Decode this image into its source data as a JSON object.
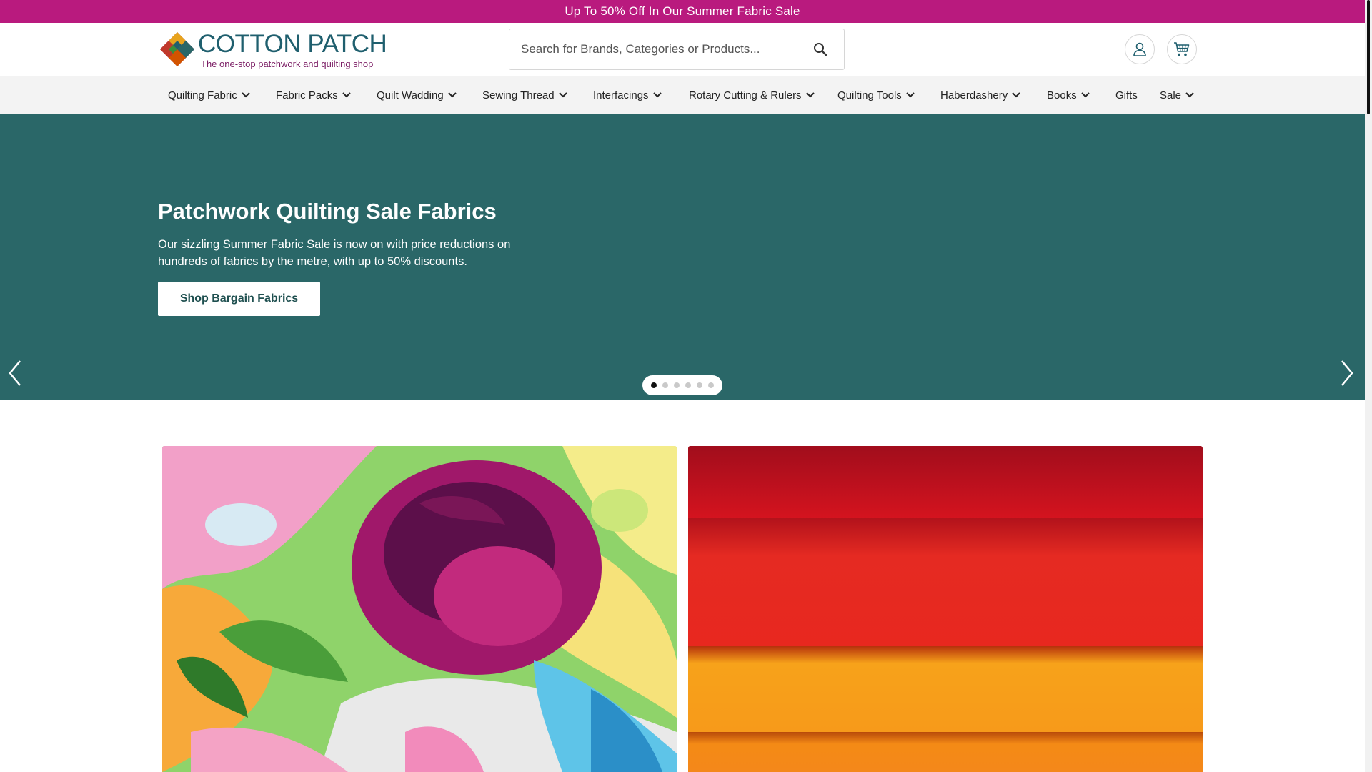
{
  "promo": {
    "text": "Up To 50% Off In Our Summer Fabric Sale"
  },
  "brand": {
    "name": "COTTON PATCH",
    "tagline": "The one-stop patchwork and quilting shop",
    "primary_color": "#1f5f6e",
    "accent_color": "#b91a7e"
  },
  "search": {
    "placeholder": "Search for Brands, Categories or Products...",
    "value": "",
    "icon": "search-icon"
  },
  "header_icons": {
    "account": "user-icon",
    "cart": "cart-icon"
  },
  "nav": {
    "items": [
      {
        "label": "Quilting Fabric",
        "has_dropdown": true
      },
      {
        "label": "Fabric Packs",
        "has_dropdown": true
      },
      {
        "label": "Quilt Wadding",
        "has_dropdown": true
      },
      {
        "label": "Sewing Thread",
        "has_dropdown": true
      },
      {
        "label": "Interfacings",
        "has_dropdown": true
      },
      {
        "label": "Rotary Cutting & Rulers",
        "has_dropdown": true
      },
      {
        "label": "Quilting Tools",
        "has_dropdown": true
      },
      {
        "label": "Haberdashery",
        "has_dropdown": true
      },
      {
        "label": "Books",
        "has_dropdown": true
      },
      {
        "label": "Gifts",
        "has_dropdown": false
      },
      {
        "label": "Sale",
        "has_dropdown": true
      }
    ]
  },
  "hero": {
    "title": "Patchwork Quilting Sale Fabrics",
    "text": "Our sizzling Summer Fabric Sale is now on with price reductions on hundreds of fabrics by the metre, with up to 50% discounts.",
    "cta": "Shop Bargain Fabrics",
    "background": "#2a6768",
    "slide_count": 6,
    "active_slide": 1
  }
}
